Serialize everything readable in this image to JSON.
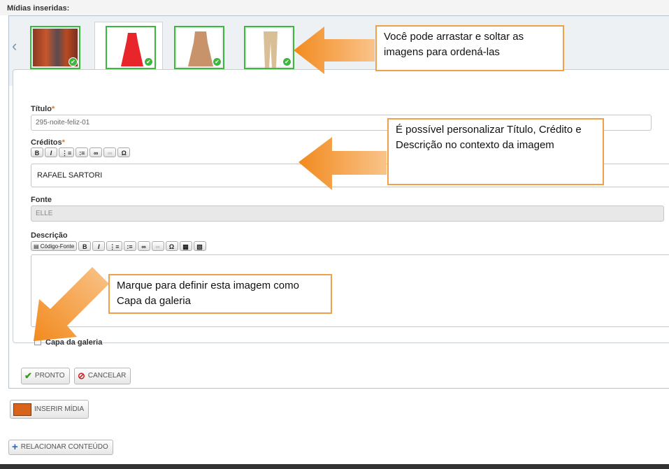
{
  "header": {
    "title": "Mídias inseridas:"
  },
  "fields": {
    "titulo": {
      "label": "Título",
      "required": "*",
      "value": "295-noite-feliz-01"
    },
    "creditos": {
      "label": "Créditos",
      "required": "*",
      "value": "RAFAEL SARTORI"
    },
    "fonte": {
      "label": "Fonte",
      "value": "ELLE"
    },
    "descricao": {
      "label": "Descrição",
      "source_btn": "Código-Fonte"
    }
  },
  "checkbox": {
    "label": "Capa da galeria"
  },
  "buttons": {
    "pronto": "PRONTO",
    "cancelar": "CANCELAR",
    "inserir": "INSERIR MÍDIA",
    "relacionar": "RELACIONAR CONTEÚDO"
  },
  "toolbar": {
    "bold": "B",
    "italic": "I",
    "omega": "Ω"
  },
  "callouts": {
    "drag": "Você pode arrastar e soltar as imagens para ordená-las",
    "custom": "É possível personalizar Título, Crédito e Descrição no contexto da imagem",
    "cover": "Marque para definir esta imagem como Capa da galeria"
  },
  "colors": {
    "accent_orange": "#f29b3a",
    "ok_green": "#3cb93c",
    "cancel_red": "#cc2222"
  }
}
